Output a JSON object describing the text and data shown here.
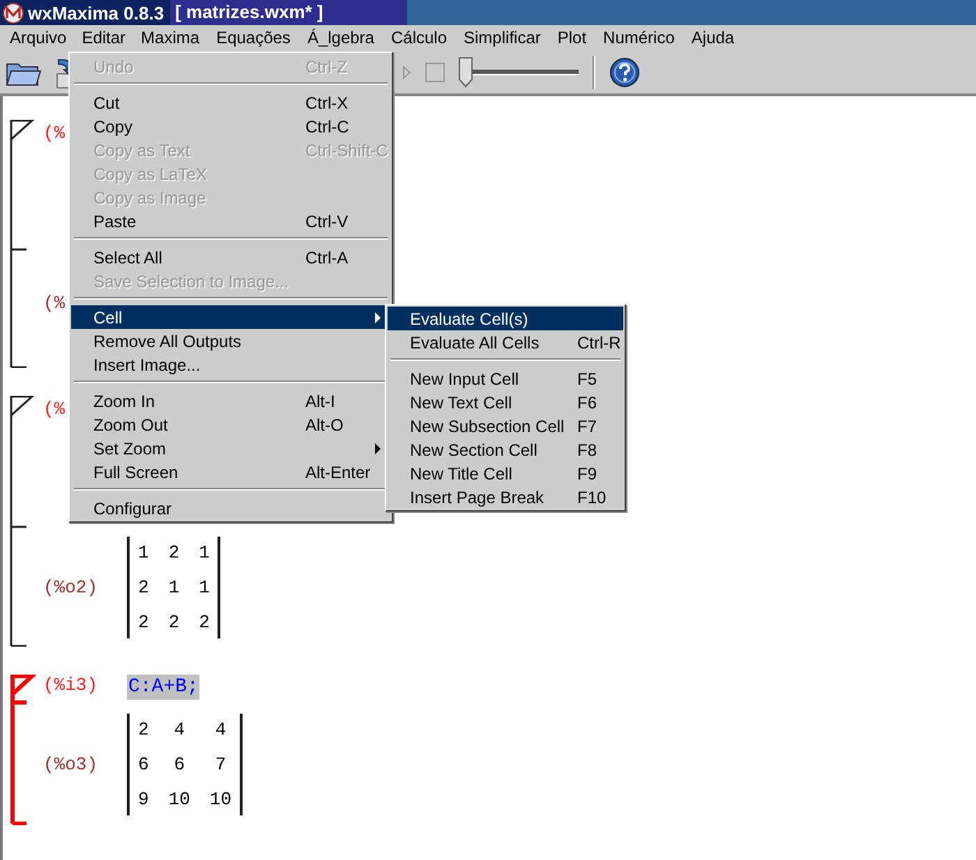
{
  "window": {
    "title": "wxMaxima 0.8.3",
    "file": "[ matrizes.wxm* ]"
  },
  "menubar": [
    {
      "label": "Arquivo",
      "selected": false
    },
    {
      "label": "Editar",
      "selected": true
    },
    {
      "label": "Maxima",
      "selected": false
    },
    {
      "label": "Equações",
      "selected": false
    },
    {
      "label": "Á_lgebra",
      "selected": false
    },
    {
      "label": "Cálculo",
      "selected": false
    },
    {
      "label": "Simplificar",
      "selected": false
    },
    {
      "label": "Plot",
      "selected": false
    },
    {
      "label": "Numérico",
      "selected": false
    },
    {
      "label": "Ajuda",
      "selected": false
    }
  ],
  "toolbar": {
    "animation_checkbox": {
      "checked": false
    },
    "animation_slider": {
      "level": 0
    }
  },
  "edit_menu": [
    {
      "kind": "item",
      "label": "Undo",
      "shortcut": "Ctrl-Z",
      "disabled": true,
      "selected": false
    },
    {
      "kind": "separator"
    },
    {
      "kind": "item",
      "label": "Cut",
      "shortcut": "Ctrl-X",
      "disabled": false,
      "selected": false
    },
    {
      "kind": "item",
      "label": "Copy",
      "shortcut": "Ctrl-C",
      "disabled": false,
      "selected": false
    },
    {
      "kind": "item",
      "label": "Copy as Text",
      "shortcut": "Ctrl-Shift-C",
      "disabled": true,
      "selected": false
    },
    {
      "kind": "item",
      "label": "Copy as LaTeX",
      "disabled": true,
      "selected": false
    },
    {
      "kind": "item",
      "label": "Copy as Image",
      "disabled": true,
      "selected": false
    },
    {
      "kind": "item",
      "label": "Paste",
      "shortcut": "Ctrl-V",
      "disabled": false,
      "selected": false
    },
    {
      "kind": "separator"
    },
    {
      "kind": "item",
      "label": "Select All",
      "shortcut": "Ctrl-A",
      "disabled": false,
      "selected": false
    },
    {
      "kind": "item",
      "label": "Save Selection to Image...",
      "disabled": true,
      "selected": false
    },
    {
      "kind": "separator"
    },
    {
      "kind": "submenu",
      "label": "Cell",
      "disabled": false,
      "selected": true
    },
    {
      "kind": "item",
      "label": "Remove All Outputs",
      "disabled": false,
      "selected": false
    },
    {
      "kind": "item",
      "label": "Insert Image...",
      "disabled": false,
      "selected": false
    },
    {
      "kind": "separator"
    },
    {
      "kind": "item",
      "label": "Zoom In",
      "shortcut": "Alt-I",
      "disabled": false,
      "selected": false
    },
    {
      "kind": "item",
      "label": "Zoom Out",
      "shortcut": "Alt-O",
      "disabled": false,
      "selected": false
    },
    {
      "kind": "submenu",
      "label": "Set Zoom",
      "disabled": false,
      "selected": false
    },
    {
      "kind": "item",
      "label": "Full Screen",
      "shortcut": "Alt-Enter",
      "disabled": false,
      "selected": false
    },
    {
      "kind": "separator"
    },
    {
      "kind": "item",
      "label": "Configurar",
      "disabled": false,
      "selected": false
    }
  ],
  "cell_submenu": [
    {
      "kind": "item",
      "label": "Evaluate Cell(s)",
      "disabled": false,
      "selected": true
    },
    {
      "kind": "item",
      "label": "Evaluate All Cells",
      "shortcut": "Ctrl-R",
      "disabled": false,
      "selected": false
    },
    {
      "kind": "separator"
    },
    {
      "kind": "item",
      "label": "New Input Cell",
      "shortcut": "F5",
      "disabled": false,
      "selected": false
    },
    {
      "kind": "item",
      "label": "New Text Cell",
      "shortcut": "F6",
      "disabled": false,
      "selected": false
    },
    {
      "kind": "item",
      "label": "New Subsection Cell",
      "shortcut": "F7",
      "disabled": false,
      "selected": false
    },
    {
      "kind": "item",
      "label": "New Section Cell",
      "shortcut": "F8",
      "disabled": false,
      "selected": false
    },
    {
      "kind": "item",
      "label": "New Title Cell",
      "shortcut": "F9",
      "disabled": false,
      "selected": false
    },
    {
      "kind": "item",
      "label": "Insert Page Break",
      "shortcut": "F10",
      "disabled": false,
      "selected": false
    }
  ],
  "document": {
    "cells": [
      {
        "active": false,
        "input_label": "(%",
        "output_label": "(%"
      },
      {
        "active": false,
        "input_label": "(%",
        "output_label": "(%o2)",
        "output_matrix": [
          [
            "1",
            "2",
            "1"
          ],
          [
            "2",
            "1",
            "1"
          ],
          [
            "2",
            "2",
            "2"
          ]
        ]
      },
      {
        "active": true,
        "input_label": "(%i3)",
        "input": "C:A+B;",
        "input_selected": true,
        "output_label": "(%o3)",
        "output_matrix": [
          [
            "2",
            "4",
            "4"
          ],
          [
            "6",
            "6",
            "7"
          ],
          [
            "9",
            "10",
            "10"
          ]
        ]
      }
    ]
  }
}
